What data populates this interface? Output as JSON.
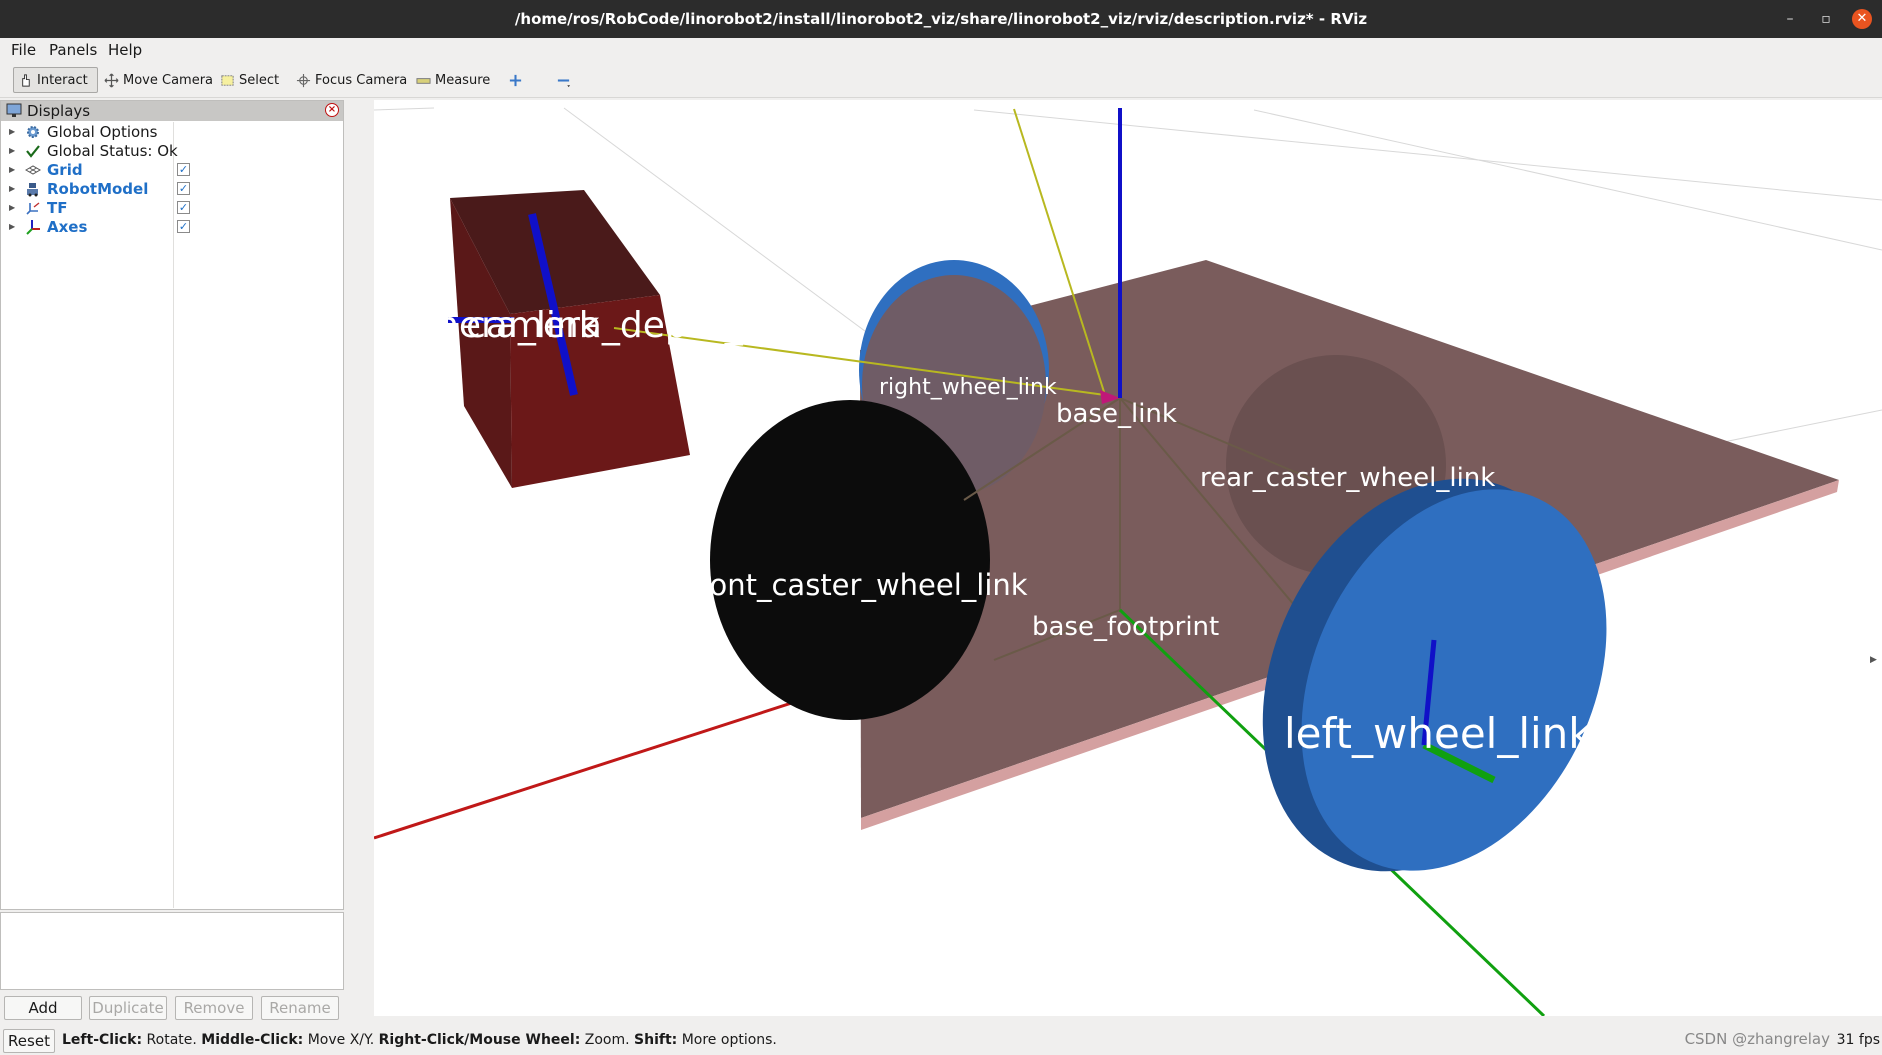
{
  "window": {
    "title": "/home/ros/RobCode/linorobot2/install/linorobot2_viz/share/linorobot2_viz/rviz/description.rviz* - RViz",
    "minimize": "–",
    "maximize": "▫",
    "close": "✕"
  },
  "menu": {
    "file": "File",
    "panels": "Panels",
    "help": "Help"
  },
  "toolbar": {
    "interact": "Interact",
    "move_camera": "Move Camera",
    "select": "Select",
    "focus_camera": "Focus Camera",
    "measure": "Measure"
  },
  "displays_panel": {
    "title": "Displays",
    "items": [
      {
        "label": "Global Options",
        "icon": "gear-icon",
        "checked": null
      },
      {
        "label": "Global Status: Ok",
        "icon": "checkmark-icon",
        "checked": null
      },
      {
        "label": "Grid",
        "icon": "grid-icon",
        "checked": true
      },
      {
        "label": "RobotModel",
        "icon": "robot-icon",
        "checked": true
      },
      {
        "label": "TF",
        "icon": "tf-icon",
        "checked": true
      },
      {
        "label": "Axes",
        "icon": "axes-icon",
        "checked": true
      }
    ]
  },
  "buttons": {
    "add": "Add",
    "duplicate": "Duplicate",
    "remove": "Remove",
    "rename": "Rename",
    "reset": "Reset"
  },
  "status": {
    "left_click_key": "Left-Click:",
    "left_click_val": " Rotate. ",
    "middle_click_key": "Middle-Click:",
    "middle_click_val": " Move X/Y. ",
    "right_click_key": "Right-Click/Mouse Wheel:",
    "right_click_val": " Zoom. ",
    "shift_key": "Shift:",
    "shift_val": " More options.",
    "fps": "31 fps",
    "watermark": "CSDN @zhangrelay"
  },
  "scene": {
    "labels": {
      "camera_link": "camera_link",
      "camera_depth_link": "camera_depth_link",
      "right_wheel_link": "right_wheel_link",
      "base_link": "base_link",
      "rear_caster_wheel_link": "rear_caster_wheel_link",
      "front_caster_wheel_link": "front_caster_wheel_link",
      "base_footprint": "base_footprint",
      "left_wheel_link": "left_wheel_link"
    },
    "colors": {
      "chassis": "#7a5c5c",
      "chassis_edge": "#d4a0a0",
      "wheel": "#2f6fc0",
      "caster_front": "#0c0c0c",
      "caster_rear": "#6a5050",
      "camera_box": "#6b1818",
      "axis_x": "#c01818",
      "axis_y": "#10a010",
      "axis_z": "#1010c8",
      "tf_line": "#b8b820"
    }
  }
}
